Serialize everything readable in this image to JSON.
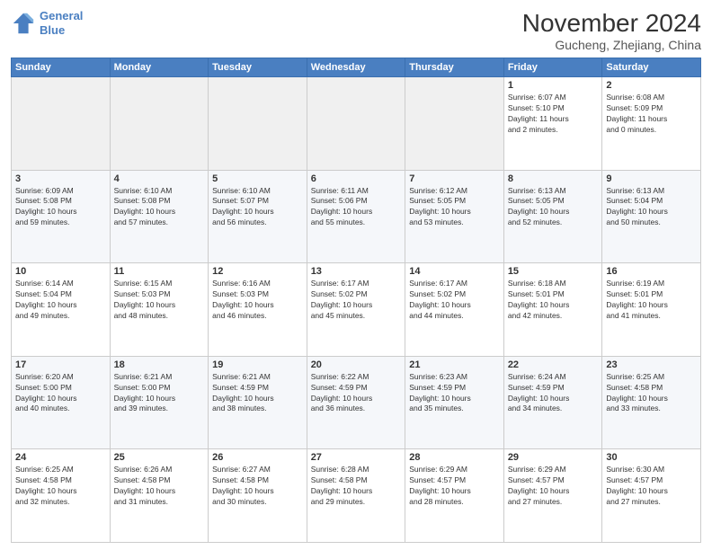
{
  "header": {
    "logo_line1": "General",
    "logo_line2": "Blue",
    "month": "November 2024",
    "location": "Gucheng, Zhejiang, China"
  },
  "weekdays": [
    "Sunday",
    "Monday",
    "Tuesday",
    "Wednesday",
    "Thursday",
    "Friday",
    "Saturday"
  ],
  "rows": [
    [
      {
        "day": "",
        "info": ""
      },
      {
        "day": "",
        "info": ""
      },
      {
        "day": "",
        "info": ""
      },
      {
        "day": "",
        "info": ""
      },
      {
        "day": "",
        "info": ""
      },
      {
        "day": "1",
        "info": "Sunrise: 6:07 AM\nSunset: 5:10 PM\nDaylight: 11 hours\nand 2 minutes."
      },
      {
        "day": "2",
        "info": "Sunrise: 6:08 AM\nSunset: 5:09 PM\nDaylight: 11 hours\nand 0 minutes."
      }
    ],
    [
      {
        "day": "3",
        "info": "Sunrise: 6:09 AM\nSunset: 5:08 PM\nDaylight: 10 hours\nand 59 minutes."
      },
      {
        "day": "4",
        "info": "Sunrise: 6:10 AM\nSunset: 5:08 PM\nDaylight: 10 hours\nand 57 minutes."
      },
      {
        "day": "5",
        "info": "Sunrise: 6:10 AM\nSunset: 5:07 PM\nDaylight: 10 hours\nand 56 minutes."
      },
      {
        "day": "6",
        "info": "Sunrise: 6:11 AM\nSunset: 5:06 PM\nDaylight: 10 hours\nand 55 minutes."
      },
      {
        "day": "7",
        "info": "Sunrise: 6:12 AM\nSunset: 5:05 PM\nDaylight: 10 hours\nand 53 minutes."
      },
      {
        "day": "8",
        "info": "Sunrise: 6:13 AM\nSunset: 5:05 PM\nDaylight: 10 hours\nand 52 minutes."
      },
      {
        "day": "9",
        "info": "Sunrise: 6:13 AM\nSunset: 5:04 PM\nDaylight: 10 hours\nand 50 minutes."
      }
    ],
    [
      {
        "day": "10",
        "info": "Sunrise: 6:14 AM\nSunset: 5:04 PM\nDaylight: 10 hours\nand 49 minutes."
      },
      {
        "day": "11",
        "info": "Sunrise: 6:15 AM\nSunset: 5:03 PM\nDaylight: 10 hours\nand 48 minutes."
      },
      {
        "day": "12",
        "info": "Sunrise: 6:16 AM\nSunset: 5:03 PM\nDaylight: 10 hours\nand 46 minutes."
      },
      {
        "day": "13",
        "info": "Sunrise: 6:17 AM\nSunset: 5:02 PM\nDaylight: 10 hours\nand 45 minutes."
      },
      {
        "day": "14",
        "info": "Sunrise: 6:17 AM\nSunset: 5:02 PM\nDaylight: 10 hours\nand 44 minutes."
      },
      {
        "day": "15",
        "info": "Sunrise: 6:18 AM\nSunset: 5:01 PM\nDaylight: 10 hours\nand 42 minutes."
      },
      {
        "day": "16",
        "info": "Sunrise: 6:19 AM\nSunset: 5:01 PM\nDaylight: 10 hours\nand 41 minutes."
      }
    ],
    [
      {
        "day": "17",
        "info": "Sunrise: 6:20 AM\nSunset: 5:00 PM\nDaylight: 10 hours\nand 40 minutes."
      },
      {
        "day": "18",
        "info": "Sunrise: 6:21 AM\nSunset: 5:00 PM\nDaylight: 10 hours\nand 39 minutes."
      },
      {
        "day": "19",
        "info": "Sunrise: 6:21 AM\nSunset: 4:59 PM\nDaylight: 10 hours\nand 38 minutes."
      },
      {
        "day": "20",
        "info": "Sunrise: 6:22 AM\nSunset: 4:59 PM\nDaylight: 10 hours\nand 36 minutes."
      },
      {
        "day": "21",
        "info": "Sunrise: 6:23 AM\nSunset: 4:59 PM\nDaylight: 10 hours\nand 35 minutes."
      },
      {
        "day": "22",
        "info": "Sunrise: 6:24 AM\nSunset: 4:59 PM\nDaylight: 10 hours\nand 34 minutes."
      },
      {
        "day": "23",
        "info": "Sunrise: 6:25 AM\nSunset: 4:58 PM\nDaylight: 10 hours\nand 33 minutes."
      }
    ],
    [
      {
        "day": "24",
        "info": "Sunrise: 6:25 AM\nSunset: 4:58 PM\nDaylight: 10 hours\nand 32 minutes."
      },
      {
        "day": "25",
        "info": "Sunrise: 6:26 AM\nSunset: 4:58 PM\nDaylight: 10 hours\nand 31 minutes."
      },
      {
        "day": "26",
        "info": "Sunrise: 6:27 AM\nSunset: 4:58 PM\nDaylight: 10 hours\nand 30 minutes."
      },
      {
        "day": "27",
        "info": "Sunrise: 6:28 AM\nSunset: 4:58 PM\nDaylight: 10 hours\nand 29 minutes."
      },
      {
        "day": "28",
        "info": "Sunrise: 6:29 AM\nSunset: 4:57 PM\nDaylight: 10 hours\nand 28 minutes."
      },
      {
        "day": "29",
        "info": "Sunrise: 6:29 AM\nSunset: 4:57 PM\nDaylight: 10 hours\nand 27 minutes."
      },
      {
        "day": "30",
        "info": "Sunrise: 6:30 AM\nSunset: 4:57 PM\nDaylight: 10 hours\nand 27 minutes."
      }
    ]
  ]
}
